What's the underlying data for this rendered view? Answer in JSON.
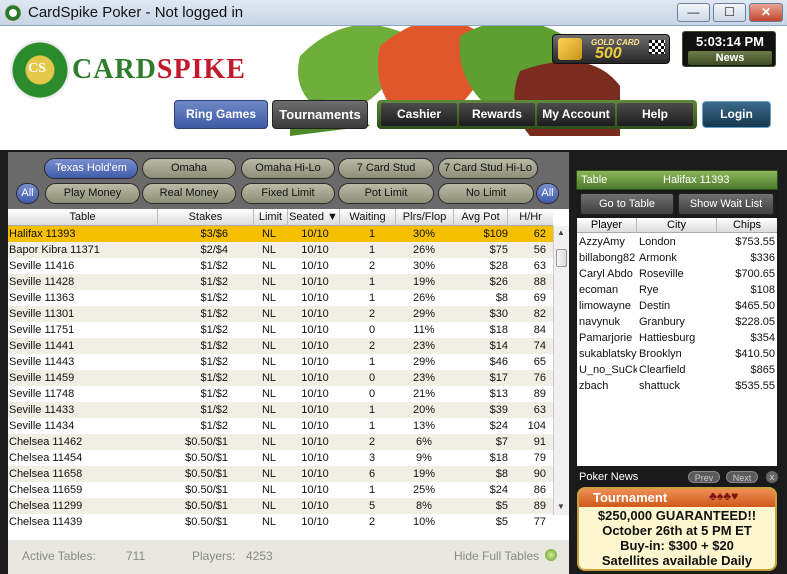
{
  "window": {
    "title": "CardSpike Poker - Not logged in",
    "min": "—",
    "max": "☐",
    "close": "✕"
  },
  "brand": {
    "emblem": "CS",
    "name_a": "CARD",
    "name_b": "SPIKE"
  },
  "gold_card": {
    "label": "GOLD CARD",
    "number": "500"
  },
  "clock": {
    "time": "5:03:14 PM",
    "news_label": "News"
  },
  "nav": {
    "ring_games": "Ring Games",
    "tournaments": "Tournaments",
    "cashier": "Cashier",
    "rewards": "Rewards",
    "my_account": "My Account",
    "help": "Help",
    "login": "Login"
  },
  "game_tabs": [
    "Texas Hold'em",
    "Omaha",
    "Omaha Hi-Lo",
    "7 Card Stud",
    "7 Card Stud Hi-Lo"
  ],
  "filters": {
    "all_left": "All",
    "play_money": "Play Money",
    "real_money": "Real Money",
    "fixed_limit": "Fixed Limit",
    "pot_limit": "Pot Limit",
    "no_limit": "No Limit",
    "all_right": "All"
  },
  "columns": [
    "Table",
    "Stakes",
    "Limit",
    "Seated",
    "Waiting",
    "Plrs/Flop",
    "Avg Pot",
    "H/Hr"
  ],
  "tables": [
    [
      "Halifax 11393",
      "$3/$6",
      "NL",
      "10/10",
      "1",
      "30%",
      "$109",
      "62"
    ],
    [
      "Bapor Kibra 11371",
      "$2/$4",
      "NL",
      "10/10",
      "1",
      "26%",
      "$75",
      "56"
    ],
    [
      "Seville 11416",
      "$1/$2",
      "NL",
      "10/10",
      "2",
      "30%",
      "$28",
      "63"
    ],
    [
      "Seville 11428",
      "$1/$2",
      "NL",
      "10/10",
      "1",
      "19%",
      "$26",
      "88"
    ],
    [
      "Seville 11363",
      "$1/$2",
      "NL",
      "10/10",
      "1",
      "26%",
      "$8",
      "69"
    ],
    [
      "Seville 11301",
      "$1/$2",
      "NL",
      "10/10",
      "2",
      "29%",
      "$30",
      "82"
    ],
    [
      "Seville 11751",
      "$1/$2",
      "NL",
      "10/10",
      "0",
      "11%",
      "$18",
      "84"
    ],
    [
      "Seville 11441",
      "$1/$2",
      "NL",
      "10/10",
      "2",
      "23%",
      "$14",
      "74"
    ],
    [
      "Seville 11443",
      "$1/$2",
      "NL",
      "10/10",
      "1",
      "29%",
      "$46",
      "65"
    ],
    [
      "Seville 11459",
      "$1/$2",
      "NL",
      "10/10",
      "0",
      "23%",
      "$17",
      "76"
    ],
    [
      "Seville 11748",
      "$1/$2",
      "NL",
      "10/10",
      "0",
      "21%",
      "$13",
      "89"
    ],
    [
      "Seville 11433",
      "$1/$2",
      "NL",
      "10/10",
      "1",
      "20%",
      "$39",
      "63"
    ],
    [
      "Seville 11434",
      "$1/$2",
      "NL",
      "10/10",
      "1",
      "13%",
      "$24",
      "104"
    ],
    [
      "Chelsea 11462",
      "$0.50/$1",
      "NL",
      "10/10",
      "2",
      "6%",
      "$7",
      "91"
    ],
    [
      "Chelsea 11454",
      "$0.50/$1",
      "NL",
      "10/10",
      "3",
      "9%",
      "$18",
      "79"
    ],
    [
      "Chelsea 11658",
      "$0.50/$1",
      "NL",
      "10/10",
      "6",
      "19%",
      "$8",
      "90"
    ],
    [
      "Chelsea 11659",
      "$0.50/$1",
      "NL",
      "10/10",
      "1",
      "25%",
      "$24",
      "86"
    ],
    [
      "Chelsea 11299",
      "$0.50/$1",
      "NL",
      "10/10",
      "5",
      "8%",
      "$5",
      "89"
    ],
    [
      "Chelsea 11439",
      "$0.50/$1",
      "NL",
      "10/10",
      "2",
      "10%",
      "$5",
      "77"
    ]
  ],
  "footer": {
    "active_tables_label": "Active Tables:",
    "active_tables_value": "711",
    "players_label": "Players:",
    "players_value": "4253",
    "hide_full": "Hide Full Tables"
  },
  "side": {
    "table_label": "Table",
    "table_name": "Halifax 11393",
    "go_to_table": "Go to Table",
    "show_wait_list": "Show Wait List",
    "columns": [
      "Player",
      "City",
      "Chips"
    ],
    "players": [
      [
        "AzzyAmy",
        "London",
        "$753.55"
      ],
      [
        "billabong82",
        "Armonk",
        "$336"
      ],
      [
        "Caryl Abdo",
        "Roseville",
        "$700.65"
      ],
      [
        "ecoman",
        "Rye",
        "$108"
      ],
      [
        "limowayne",
        "Destin",
        "$465.50"
      ],
      [
        "navynuk",
        "Granbury",
        "$228.05"
      ],
      [
        "Pamarjorie",
        "Hattiesburg",
        "$354"
      ],
      [
        "sukablatsky",
        "Brooklyn",
        "$410.50"
      ],
      [
        "U_no_SuCk",
        "Clearfield",
        "$865"
      ],
      [
        "zbach",
        "shattuck",
        "$535.55"
      ]
    ],
    "news_label": "Poker News",
    "prev": "Prev",
    "next": "Next",
    "close": "x"
  },
  "promo": {
    "heading": "Tournament",
    "suits": "♣♠♣♥",
    "line1": "$250,000 GUARANTEED!!",
    "line2": "October 26th at 5 PM ET",
    "line3": "Buy-in: $300 + $20",
    "line4": "Satellites available Daily"
  },
  "colors": {
    "accent_green": "#4d7a2b",
    "selected_row": "#f6bf00",
    "brand_red": "#c2192c",
    "brand_green": "#2f7d2c"
  }
}
